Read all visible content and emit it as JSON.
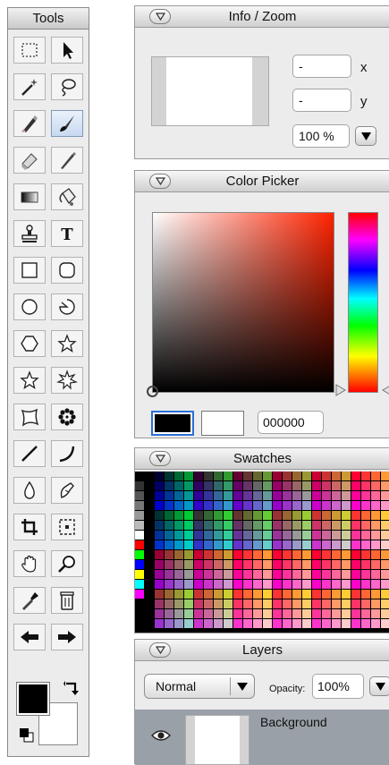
{
  "tools_panel": {
    "title": "Tools",
    "tools": [
      {
        "icon": "marquee-select-icon"
      },
      {
        "icon": "move-arrow-icon"
      },
      {
        "icon": "magic-wand-icon"
      },
      {
        "icon": "lasso-icon"
      },
      {
        "icon": "pencil-icon"
      },
      {
        "icon": "brush-icon",
        "selected": true
      },
      {
        "icon": "eraser-icon"
      },
      {
        "icon": "pen-icon"
      },
      {
        "icon": "gradient-icon"
      },
      {
        "icon": "paint-bucket-icon"
      },
      {
        "icon": "clone-stamp-icon"
      },
      {
        "icon": "text-icon",
        "glyph": "T"
      },
      {
        "icon": "rectangle-icon"
      },
      {
        "icon": "rounded-rectangle-icon"
      },
      {
        "icon": "ellipse-icon"
      },
      {
        "icon": "freeform-shape-icon"
      },
      {
        "icon": "hexagon-icon"
      },
      {
        "icon": "star-icon"
      },
      {
        "icon": "star-outline-icon"
      },
      {
        "icon": "burst-star-icon"
      },
      {
        "icon": "blob-shape-icon"
      },
      {
        "icon": "flower-icon"
      },
      {
        "icon": "line-icon"
      },
      {
        "icon": "curve-icon"
      },
      {
        "icon": "blur-drop-icon"
      },
      {
        "icon": "smudge-icon"
      },
      {
        "icon": "crop-icon"
      },
      {
        "icon": "resize-icon"
      },
      {
        "icon": "hand-pan-icon"
      },
      {
        "icon": "zoom-magnifier-icon"
      },
      {
        "icon": "eyedropper-icon"
      },
      {
        "icon": "trash-icon"
      },
      {
        "icon": "arrow-left-icon"
      },
      {
        "icon": "arrow-right-icon"
      }
    ],
    "foreground_color": "#000000",
    "background_color": "#ffffff"
  },
  "info_zoom": {
    "title": "Info / Zoom",
    "x_value": "-",
    "x_label": "x",
    "y_value": "-",
    "y_label": "y",
    "zoom_value": "100 %"
  },
  "color_picker": {
    "title": "Color Picker",
    "current_color": "#000000",
    "previous_color": "#ffffff",
    "hex_value": "000000",
    "hue_color": "#ff2200"
  },
  "swatches": {
    "title": "Swatches"
  },
  "layers": {
    "title": "Layers",
    "blend_mode": "Normal",
    "opacity_label": "Opacity:",
    "opacity_value": "100%",
    "items": [
      {
        "name": "Background",
        "visible": true
      }
    ]
  }
}
